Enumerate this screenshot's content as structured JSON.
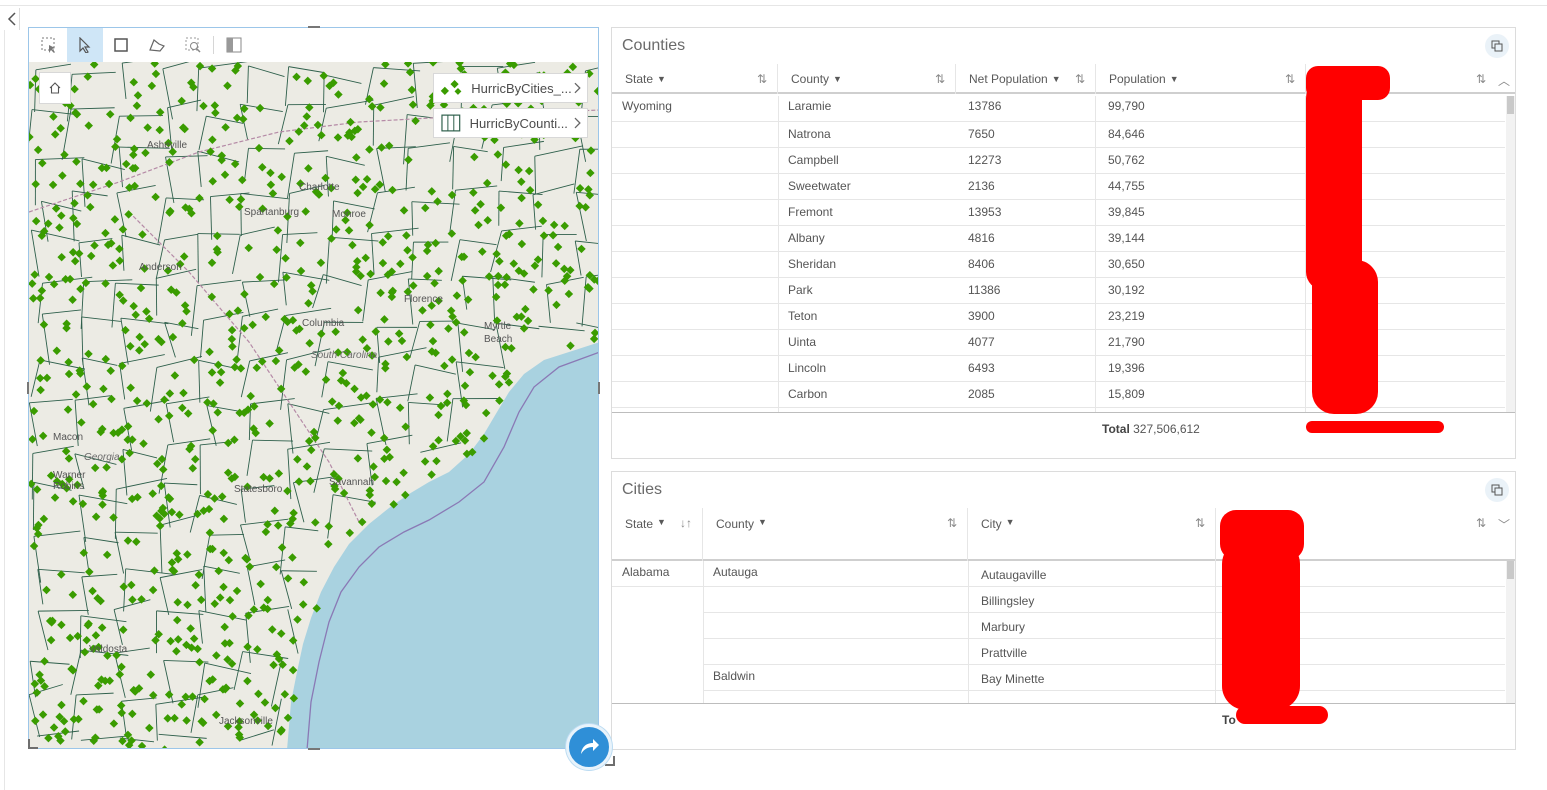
{
  "map": {
    "layers": [
      {
        "name": "HurricByCities_...",
        "icon": "diamond-points-icon"
      },
      {
        "name": "HurricByCounti...",
        "icon": "polygon-layer-icon"
      }
    ],
    "labels": {
      "states": [
        "South Carolina",
        "Georgia"
      ],
      "cities": [
        "Asheville",
        "Charlotte",
        "Spartanburg",
        "Monroe",
        "Anderson",
        "Columbia",
        "Florence",
        "Myrtle Beach",
        "Macon",
        "Savannah",
        "Statesboro",
        "Warner Robins",
        "Valdosta",
        "Jacksonville"
      ]
    },
    "colors": {
      "land": "#ecebe4",
      "water": "#a9d2e0",
      "points": "#3a9c00",
      "county_lines": "#2e5f4b"
    }
  },
  "counties": {
    "title": "Counties",
    "columns": [
      {
        "label": "State"
      },
      {
        "label": "County"
      },
      {
        "label": "Net Population"
      },
      {
        "label": "Population"
      }
    ],
    "state_group": "Wyoming",
    "rows": [
      {
        "county": "Laramie",
        "net": "13786",
        "pop": "99,790"
      },
      {
        "county": "Natrona",
        "net": "7650",
        "pop": "84,646"
      },
      {
        "county": "Campbell",
        "net": "12273",
        "pop": "50,762"
      },
      {
        "county": "Sweetwater",
        "net": "2136",
        "pop": "44,755"
      },
      {
        "county": "Fremont",
        "net": "13953",
        "pop": "39,845"
      },
      {
        "county": "Albany",
        "net": "4816",
        "pop": "39,144"
      },
      {
        "county": "Sheridan",
        "net": "8406",
        "pop": "30,650"
      },
      {
        "county": "Park",
        "net": "11386",
        "pop": "30,192"
      },
      {
        "county": "Teton",
        "net": "3900",
        "pop": "23,219"
      },
      {
        "county": "Uinta",
        "net": "4077",
        "pop": "21,790"
      },
      {
        "county": "Lincoln",
        "net": "6493",
        "pop": "19,396"
      },
      {
        "county": "Carbon",
        "net": "2085",
        "pop": "15,809"
      }
    ],
    "total_label": "Total",
    "total_value": "327,506,612"
  },
  "cities": {
    "title": "Cities",
    "columns": [
      {
        "label": "State"
      },
      {
        "label": "County"
      },
      {
        "label": "City"
      }
    ],
    "rows": [
      {
        "state": "Alabama",
        "county": "Autauga",
        "city": "Autaugaville"
      },
      {
        "state": "",
        "county": "",
        "city": "Billingsley"
      },
      {
        "state": "",
        "county": "",
        "city": "Marbury"
      },
      {
        "state": "",
        "county": "",
        "city": "Prattville"
      },
      {
        "state": "",
        "county": "Baldwin",
        "city": "Bay Minette"
      }
    ],
    "total_label": "To"
  }
}
